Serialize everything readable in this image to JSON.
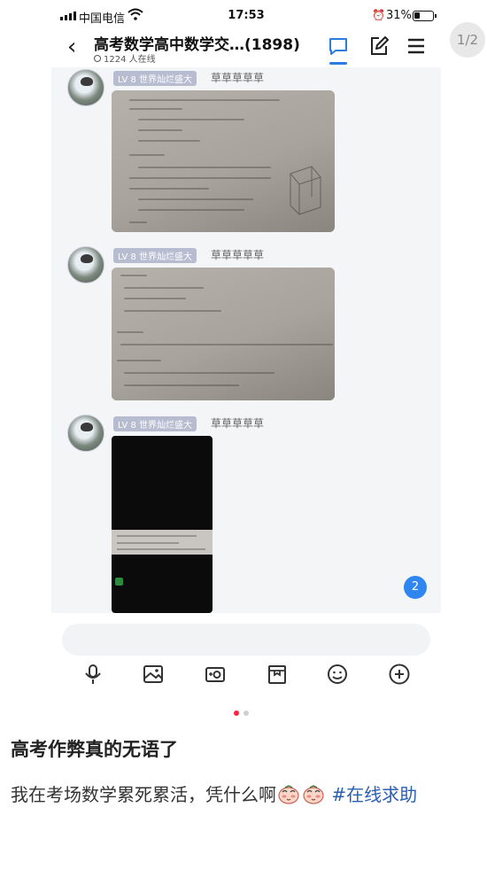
{
  "status_bar": {
    "carrier": "中国电信",
    "time": "17:53",
    "battery": "31%",
    "battery_level": 0.31
  },
  "chat_header": {
    "title": "高考数学高中数学交…(1898)",
    "online": "1224 人在线"
  },
  "messages": [
    {
      "level_badge": "LV 8  世界灿烂盛大",
      "username": "草草草草草"
    },
    {
      "level_badge": "LV 8  世界灿烂盛大",
      "username": "草草草草草"
    },
    {
      "level_badge": "LV 8  世界灿烂盛大",
      "username": "草草草草草"
    }
  ],
  "unread_count": "2",
  "pager": "1/2",
  "post": {
    "title": "高考作弊真的无语了",
    "body": "我在考场数学累死累活，凭什么啊",
    "hashtag": "#在线求助"
  },
  "colors": {
    "accent_blue": "#2b7be0",
    "indicator_red": "#ff2442",
    "hashtag_blue": "#2a5fb0"
  }
}
